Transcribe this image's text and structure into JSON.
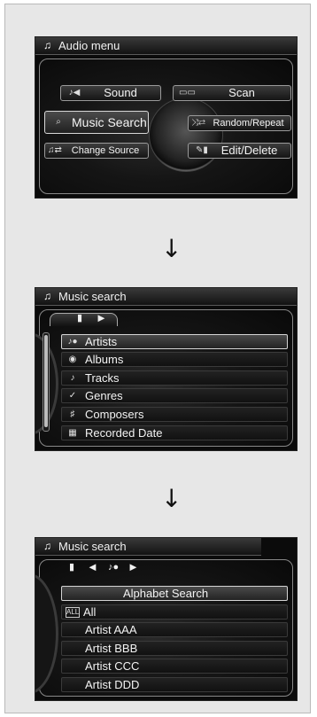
{
  "screen1": {
    "title": "Audio menu",
    "title_icon": "music-note-icon",
    "buttons": {
      "sound": {
        "label": "Sound",
        "icon": "sound-icon"
      },
      "scan": {
        "label": "Scan",
        "icon": "scan-icon"
      },
      "music_search": {
        "label": "Music Search",
        "icon": "search-icon"
      },
      "random_repeat": {
        "label": "Random/Repeat",
        "icon": "shuffle-repeat-icon"
      },
      "change_source": {
        "label": "Change Source",
        "icon": "change-source-icon"
      },
      "edit_delete": {
        "label": "Edit/Delete",
        "icon": "edit-delete-icon"
      }
    }
  },
  "screen2": {
    "title": "Music search",
    "title_icon": "music-note-icon",
    "items": [
      {
        "label": "Artists",
        "icon": "artist-icon"
      },
      {
        "label": "Albums",
        "icon": "album-icon"
      },
      {
        "label": "Tracks",
        "icon": "music-note-icon"
      },
      {
        "label": "Genres",
        "icon": "genre-icon"
      },
      {
        "label": "Composers",
        "icon": "composer-icon"
      },
      {
        "label": "Recorded Date",
        "icon": "calendar-icon"
      }
    ]
  },
  "screen3": {
    "title": "Music search",
    "title_icon": "music-note-icon",
    "items": [
      {
        "label": "Alphabet Search"
      },
      {
        "label": "All",
        "icon": "all-icon"
      },
      {
        "label": "Artist AAA"
      },
      {
        "label": "Artist BBB"
      },
      {
        "label": "Artist CCC"
      },
      {
        "label": "Artist DDD"
      }
    ]
  },
  "colors": {
    "screen_bg": "#0b0b0b",
    "page_bg": "#e7e7e7",
    "text": "#f3f3f3"
  }
}
